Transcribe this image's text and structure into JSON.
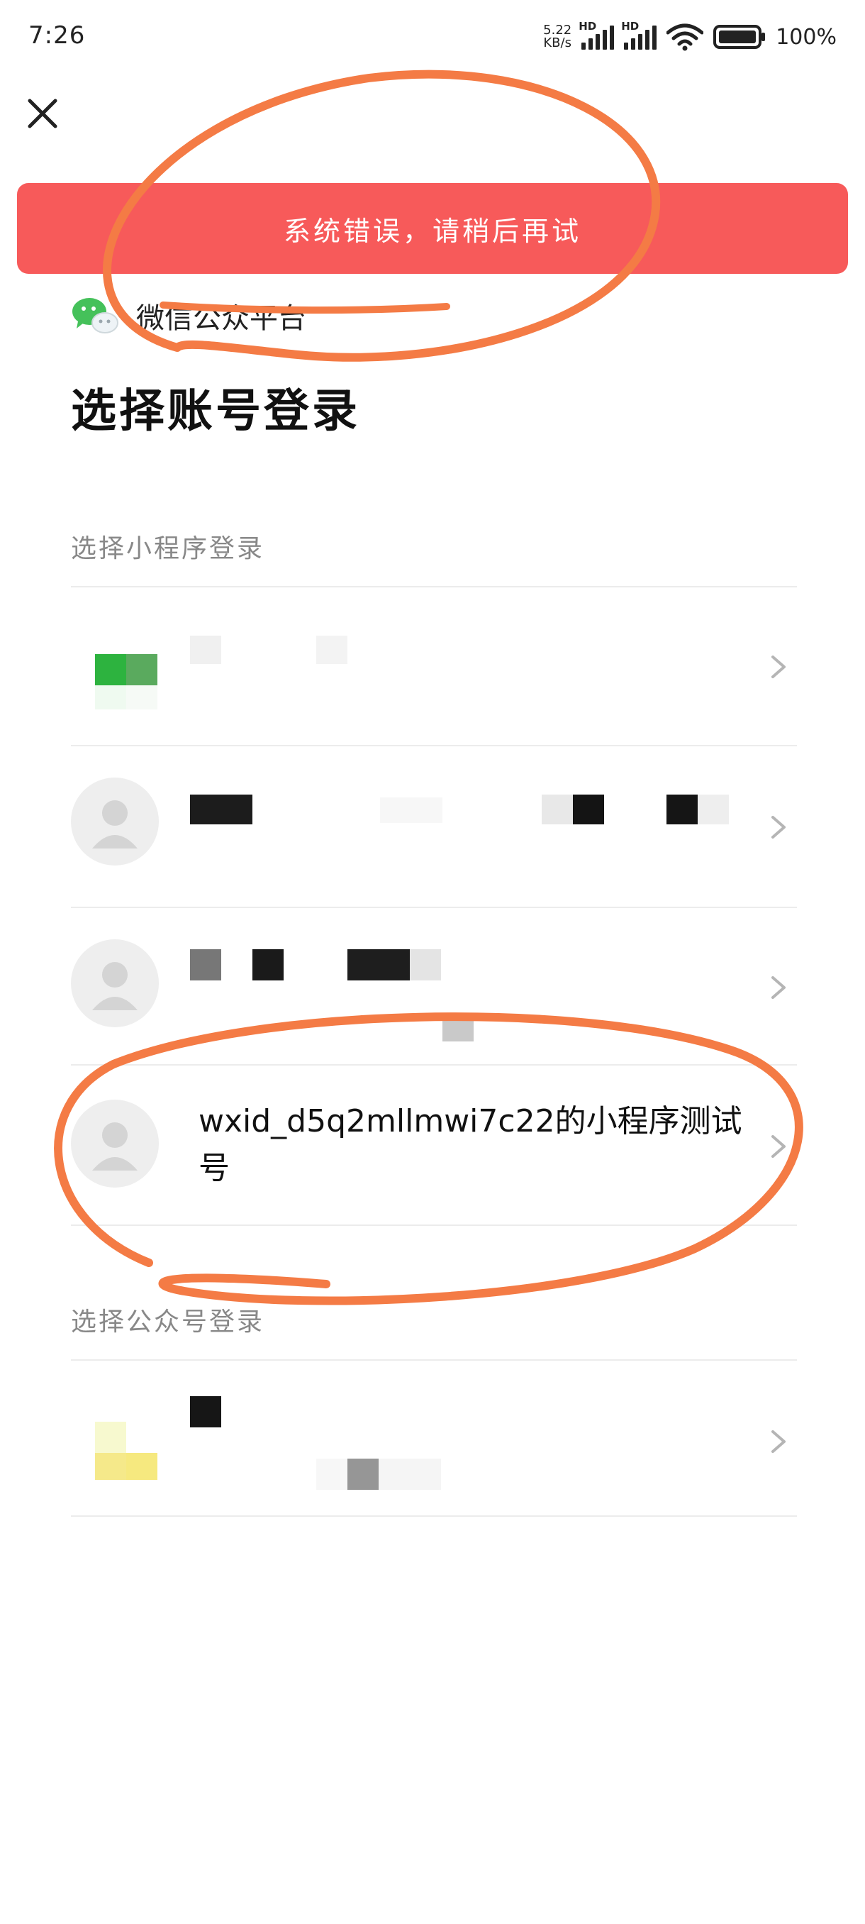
{
  "status_bar": {
    "time": "7:26",
    "net_speed_value": "5.22",
    "net_speed_unit": "KB/s",
    "signal1_label": "HD",
    "signal2_label": "HD",
    "battery_percent": "100%"
  },
  "toast": {
    "message": "系统错误，请稍后再试"
  },
  "platform": {
    "name": "微信公众平台",
    "icon": "wechat-logo-icon"
  },
  "page_title": "选择账号登录",
  "mini_program_section": {
    "label": "选择小程序登录",
    "items": [
      {
        "name": "",
        "avatar": "blurred-green"
      },
      {
        "name": "",
        "avatar": "default-person"
      },
      {
        "name": "",
        "avatar": "default-person"
      },
      {
        "name": "wxid_d5q2mllmwi7c22的小程序测试号",
        "avatar": "default-person"
      }
    ]
  },
  "official_account_section": {
    "label": "选择公众号登录",
    "items": [
      {
        "name": "",
        "avatar": "blurred-yellow"
      }
    ]
  },
  "colors": {
    "toast_bg": "#f75a5a",
    "annotation": "#f47b45",
    "wechat_green": "#45c15a"
  }
}
